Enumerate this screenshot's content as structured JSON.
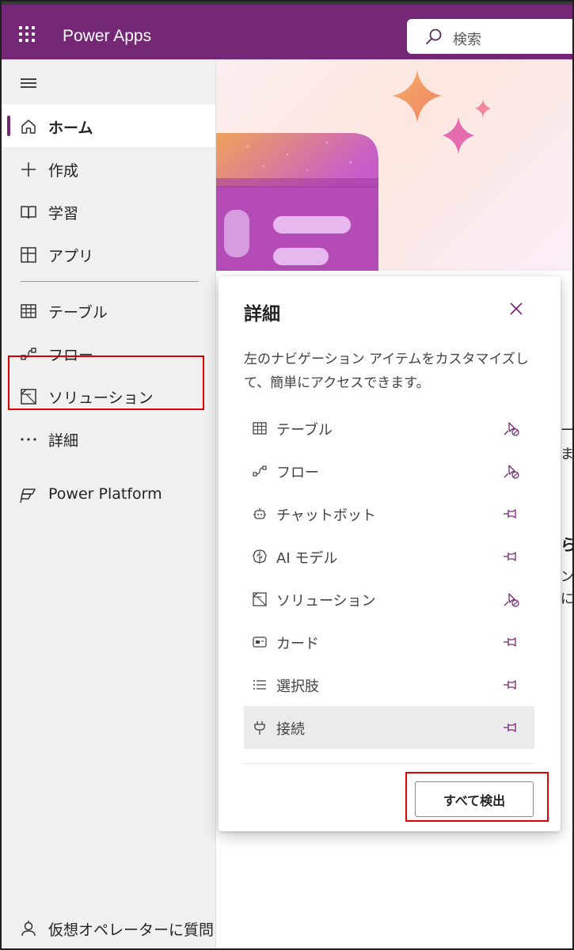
{
  "header": {
    "app_title": "Power Apps",
    "search_placeholder": "検索",
    "brand_color": "#742774"
  },
  "sidebar": {
    "items": [
      {
        "label": "ホーム",
        "icon": "home-icon",
        "active": true
      },
      {
        "label": "作成",
        "icon": "plus-icon"
      },
      {
        "label": "学習",
        "icon": "book-icon"
      },
      {
        "label": "アプリ",
        "icon": "apps-icon"
      },
      {
        "label": "テーブル",
        "icon": "table-icon"
      },
      {
        "label": "フロー",
        "icon": "flow-icon"
      },
      {
        "label": "ソリューション",
        "icon": "solution-icon"
      },
      {
        "label": "詳細",
        "icon": "more-icon"
      },
      {
        "label": "Power Platform",
        "icon": "power-platform-icon"
      }
    ],
    "bottom_label": "仮想オペレーターに質問"
  },
  "popup": {
    "title": "詳細",
    "description": "左のナビゲーション アイテムをカスタマイズして、簡単にアクセスできます。",
    "items": [
      {
        "label": "テーブル",
        "icon": "table-icon",
        "pinned": true
      },
      {
        "label": "フロー",
        "icon": "flow-icon",
        "pinned": true
      },
      {
        "label": "チャットボット",
        "icon": "chatbot-icon",
        "pinned": false
      },
      {
        "label": "AI モデル",
        "icon": "ai-model-icon",
        "pinned": false
      },
      {
        "label": "ソリューション",
        "icon": "solution-icon",
        "pinned": true
      },
      {
        "label": "カード",
        "icon": "card-icon",
        "pinned": false
      },
      {
        "label": "選択肢",
        "icon": "choices-icon",
        "pinned": false
      },
      {
        "label": "接続",
        "icon": "connection-icon",
        "pinned": false,
        "selected": true
      }
    ],
    "discover_all_label": "すべて検出"
  },
  "peek": {
    "line1": "ーブ",
    "line2": "ます",
    "line3": "ら",
    "line4": "ン",
    "line5": "に"
  }
}
